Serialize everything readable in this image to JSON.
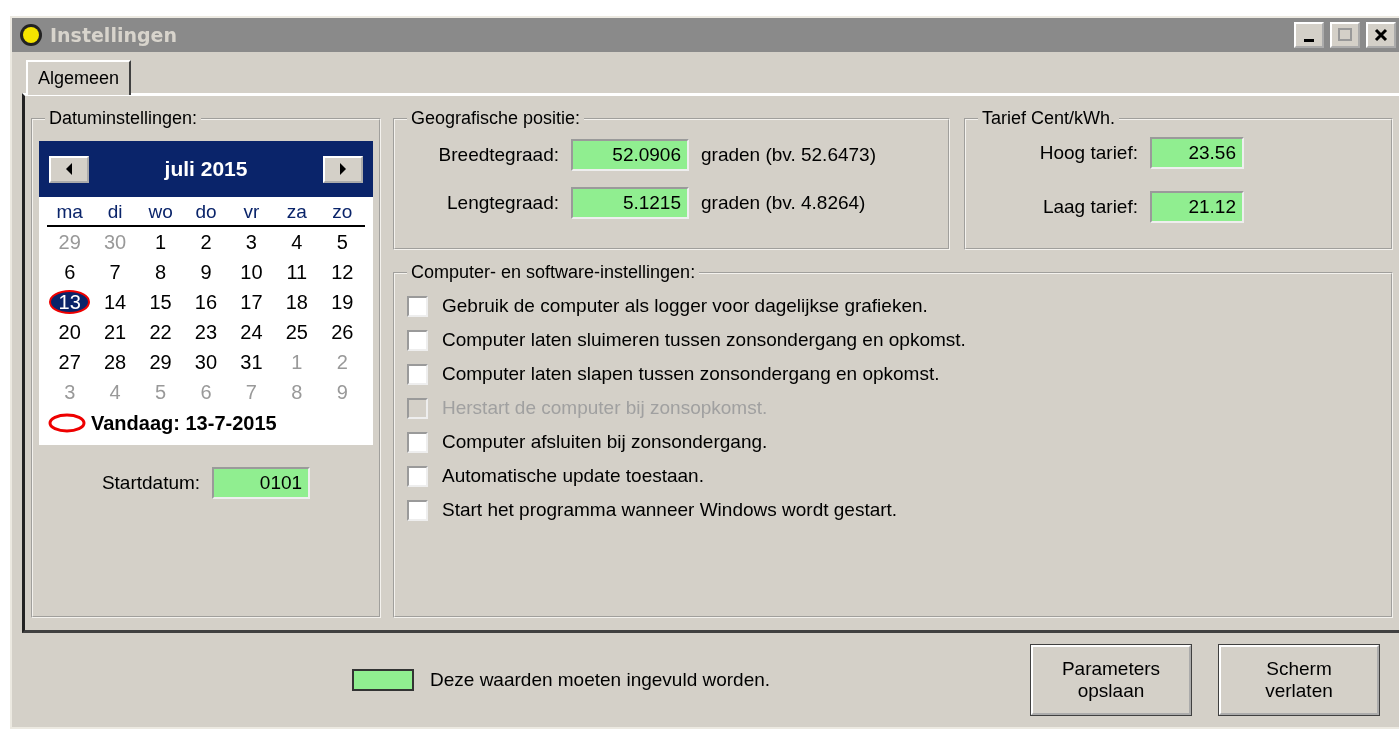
{
  "window": {
    "title": "Instellingen"
  },
  "tabs": [
    {
      "label": "Algemeen",
      "selected": true
    }
  ],
  "date_settings": {
    "title": "Datuminstellingen:",
    "calendar": {
      "month_label": "juli 2015",
      "weekdays": [
        "ma",
        "di",
        "wo",
        "do",
        "vr",
        "za",
        "zo"
      ],
      "weeks": [
        [
          {
            "label": "29",
            "muted": true,
            "selected": false
          },
          {
            "label": "30",
            "muted": true,
            "selected": false
          },
          {
            "label": "1",
            "muted": false,
            "selected": false
          },
          {
            "label": "2",
            "muted": false,
            "selected": false
          },
          {
            "label": "3",
            "muted": false,
            "selected": false
          },
          {
            "label": "4",
            "muted": false,
            "selected": false
          },
          {
            "label": "5",
            "muted": false,
            "selected": false
          }
        ],
        [
          {
            "label": "6",
            "muted": false,
            "selected": false
          },
          {
            "label": "7",
            "muted": false,
            "selected": false
          },
          {
            "label": "8",
            "muted": false,
            "selected": false
          },
          {
            "label": "9",
            "muted": false,
            "selected": false
          },
          {
            "label": "10",
            "muted": false,
            "selected": false
          },
          {
            "label": "11",
            "muted": false,
            "selected": false
          },
          {
            "label": "12",
            "muted": false,
            "selected": false
          }
        ],
        [
          {
            "label": "13",
            "muted": false,
            "selected": true
          },
          {
            "label": "14",
            "muted": false,
            "selected": false
          },
          {
            "label": "15",
            "muted": false,
            "selected": false
          },
          {
            "label": "16",
            "muted": false,
            "selected": false
          },
          {
            "label": "17",
            "muted": false,
            "selected": false
          },
          {
            "label": "18",
            "muted": false,
            "selected": false
          },
          {
            "label": "19",
            "muted": false,
            "selected": false
          }
        ],
        [
          {
            "label": "20",
            "muted": false,
            "selected": false
          },
          {
            "label": "21",
            "muted": false,
            "selected": false
          },
          {
            "label": "22",
            "muted": false,
            "selected": false
          },
          {
            "label": "23",
            "muted": false,
            "selected": false
          },
          {
            "label": "24",
            "muted": false,
            "selected": false
          },
          {
            "label": "25",
            "muted": false,
            "selected": false
          },
          {
            "label": "26",
            "muted": false,
            "selected": false
          }
        ],
        [
          {
            "label": "27",
            "muted": false,
            "selected": false
          },
          {
            "label": "28",
            "muted": false,
            "selected": false
          },
          {
            "label": "29",
            "muted": false,
            "selected": false
          },
          {
            "label": "30",
            "muted": false,
            "selected": false
          },
          {
            "label": "31",
            "muted": false,
            "selected": false
          },
          {
            "label": "1",
            "muted": true,
            "selected": false
          },
          {
            "label": "2",
            "muted": true,
            "selected": false
          }
        ],
        [
          {
            "label": "3",
            "muted": true,
            "selected": false
          },
          {
            "label": "4",
            "muted": true,
            "selected": false
          },
          {
            "label": "5",
            "muted": true,
            "selected": false
          },
          {
            "label": "6",
            "muted": true,
            "selected": false
          },
          {
            "label": "7",
            "muted": true,
            "selected": false
          },
          {
            "label": "8",
            "muted": true,
            "selected": false
          },
          {
            "label": "9",
            "muted": true,
            "selected": false
          }
        ]
      ],
      "today": "Vandaag: 13-7-2015"
    },
    "start_date": {
      "label": "Startdatum:",
      "value": "0101"
    }
  },
  "geo": {
    "title": "Geografische positie:",
    "fields": [
      {
        "label": "Breedtegraad:",
        "value": "52.0906",
        "hint": "graden (bv. 52.6473)"
      },
      {
        "label": "Lengtegraad:",
        "value": "5.1215",
        "hint": "graden (bv. 4.8264)"
      }
    ]
  },
  "tariff": {
    "title": "Tarief Cent/kWh.",
    "fields": [
      {
        "label": "Hoog tarief:",
        "value": "23.56"
      },
      {
        "label": "Laag tarief:",
        "value": "21.12"
      }
    ]
  },
  "computer": {
    "title": "Computer- en software-instellingen:",
    "options": [
      {
        "label": "Gebruik de computer als logger voor dagelijkse grafieken.",
        "checked": false,
        "disabled": false
      },
      {
        "label": "Computer laten sluimeren tussen zonsondergang en opkomst.",
        "checked": false,
        "disabled": false
      },
      {
        "label": "Computer laten slapen tussen zonsondergang en opkomst.",
        "checked": false,
        "disabled": false
      },
      {
        "label": "Herstart de computer bij zonsopkomst.",
        "checked": false,
        "disabled": true
      },
      {
        "label": "Computer afsluiten bij zonsondergang.",
        "checked": false,
        "disabled": false
      },
      {
        "label": "Automatische update toestaan.",
        "checked": false,
        "disabled": false
      },
      {
        "label": "Start het programma wanneer Windows wordt gestart.",
        "checked": false,
        "disabled": false
      }
    ]
  },
  "legend": "Deze waarden moeten ingevuld worden.",
  "buttons": [
    "Parameters opslaan",
    "Scherm verlaten"
  ]
}
